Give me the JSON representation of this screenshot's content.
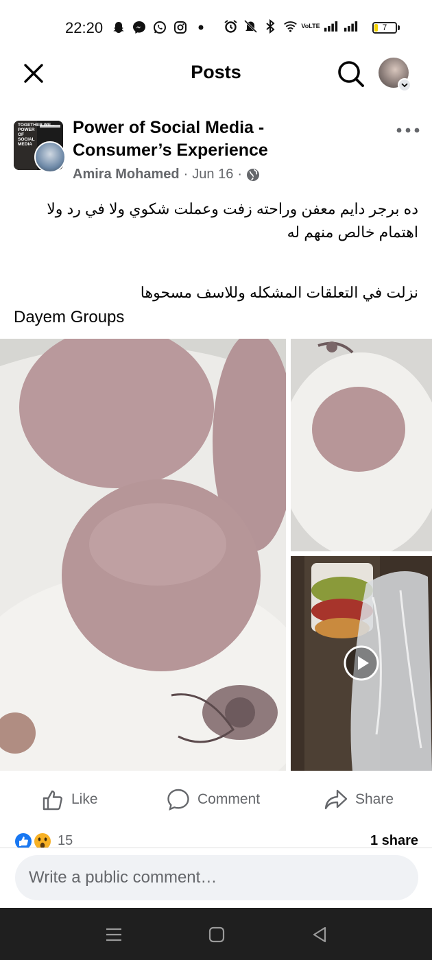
{
  "status_bar": {
    "time": "22:20",
    "battery": "7",
    "icons_left": [
      "snapchat-icon",
      "messenger-icon",
      "whatsapp-icon",
      "instagram-icon",
      "dot-icon"
    ],
    "icons_right": [
      "alarm-icon",
      "mute-icon",
      "bluetooth-icon",
      "wifi-icon",
      "volte-icon",
      "signal-icon",
      "signal-icon"
    ]
  },
  "header": {
    "title": "Posts"
  },
  "post": {
    "group_name": "Power of Social Media - Consumer’s Experience",
    "group_avatar_text": "TOGETHER WE...\nPOWER\nOF\nSOCIAL\nMEDIA",
    "author": "Amira Mohamed",
    "separator": "·",
    "date": "Jun 16",
    "text_ar_1": "ده برجر دايم معفن  وراحته زفت وعملت شكوي ولا في رد ولا اهتمام خالص  منهم له",
    "text_ar_2": "نزلت في التعلقات المشكله وللاسف مسحوها",
    "text_en": "Dayem Groups"
  },
  "actions": {
    "like": "Like",
    "comment": "Comment",
    "share": "Share"
  },
  "reactions": {
    "count": "15",
    "shares": "1 share",
    "types": [
      "like-icon",
      "wow-icon"
    ]
  },
  "comment_box": {
    "placeholder": "Write a public comment…"
  },
  "colors": {
    "text": "#050505",
    "secondary": "#65676b",
    "like_blue": "#1877f2",
    "input_bg": "#f0f2f5",
    "nav_bg": "#1f1f1f"
  }
}
